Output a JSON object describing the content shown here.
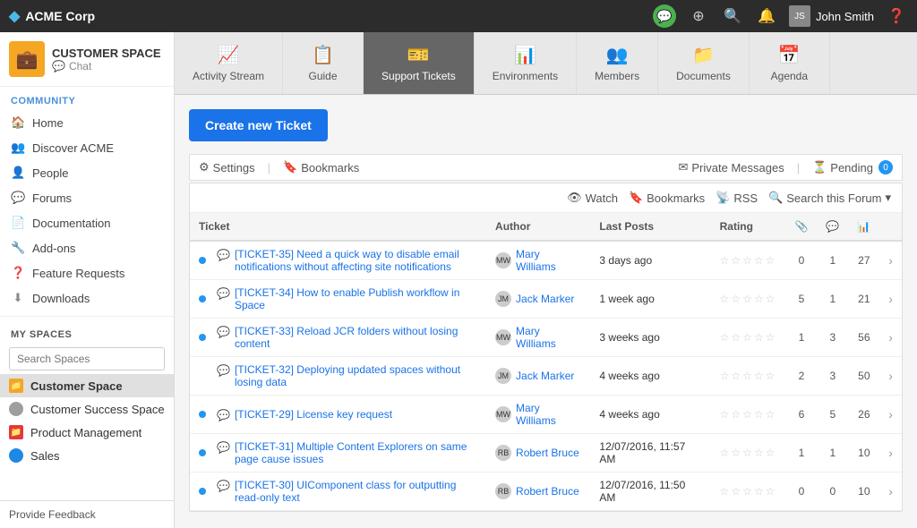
{
  "app": {
    "name": "ACME Corp"
  },
  "topnav": {
    "username": "John Smith",
    "icons": [
      "chat",
      "add",
      "search",
      "bell",
      "user",
      "help"
    ]
  },
  "sidebar": {
    "space_title": "CUSTOMER SPACE",
    "space_chat": "Chat",
    "community_title": "COMMUNITY",
    "nav_items": [
      {
        "label": "Home",
        "icon": "🏠"
      },
      {
        "label": "Discover ACME",
        "icon": "👥"
      },
      {
        "label": "People",
        "icon": "👤"
      },
      {
        "label": "Forums",
        "icon": "💬"
      },
      {
        "label": "Documentation",
        "icon": "📄"
      },
      {
        "label": "Add-ons",
        "icon": "🔧"
      },
      {
        "label": "Feature Requests",
        "icon": "❓"
      },
      {
        "label": "Downloads",
        "icon": "⬇"
      }
    ],
    "my_spaces_title": "MY SPACES",
    "search_spaces_placeholder": "Search Spaces",
    "spaces": [
      {
        "label": "Customer Space",
        "color": "#f5a623",
        "active": true
      },
      {
        "label": "Customer Success Space",
        "color": "#9e9e9e"
      },
      {
        "label": "Product Management",
        "color": "#e53935"
      },
      {
        "label": "Sales",
        "color": "#1e88e5"
      }
    ],
    "provide_feedback": "Provide Feedback"
  },
  "tabs": [
    {
      "label": "Activity Stream",
      "icon": "📈"
    },
    {
      "label": "Guide",
      "icon": "📋"
    },
    {
      "label": "Support Tickets",
      "icon": "🎫",
      "active": true
    },
    {
      "label": "Environments",
      "icon": "📊"
    },
    {
      "label": "Members",
      "icon": "👥"
    },
    {
      "label": "Documents",
      "icon": "📁"
    },
    {
      "label": "Agenda",
      "icon": "📅"
    }
  ],
  "page": {
    "create_ticket_label": "Create new Ticket",
    "toolbar": {
      "settings_label": "Settings",
      "bookmarks_label": "Bookmarks",
      "private_messages_label": "Private Messages",
      "pending_label": "Pending",
      "pending_count": "0"
    },
    "table_toolbar": {
      "watch_label": "Watch",
      "bookmarks_label": "Bookmarks",
      "rss_label": "RSS",
      "search_label": "Search this Forum"
    },
    "columns": [
      "Ticket",
      "Author",
      "Last Posts",
      "Rating",
      "",
      "",
      ""
    ],
    "tickets": [
      {
        "unread": true,
        "id": "TICKET-35",
        "title": "Need a quick way to disable email notifications without affecting site notifications",
        "author": "Mary Williams",
        "last_post": "3 days ago",
        "stars": "☆☆☆☆☆",
        "attach": "0",
        "replies": "1",
        "views": "27"
      },
      {
        "unread": true,
        "id": "TICKET-34",
        "title": "How to enable Publish workflow in Space",
        "author": "Jack Marker",
        "last_post": "1 week ago",
        "stars": "☆☆☆☆☆",
        "attach": "5",
        "replies": "1",
        "views": "21"
      },
      {
        "unread": true,
        "id": "TICKET-33",
        "title": "Reload JCR folders without losing content",
        "author": "Mary Williams",
        "last_post": "3 weeks ago",
        "stars": "☆☆☆☆☆",
        "attach": "1",
        "replies": "3",
        "views": "56"
      },
      {
        "unread": false,
        "id": "TICKET-32",
        "title": "Deploying updated spaces without losing data",
        "author": "Jack Marker",
        "last_post": "4 weeks ago",
        "stars": "☆☆☆☆☆",
        "attach": "2",
        "replies": "3",
        "views": "50"
      },
      {
        "unread": true,
        "id": "TICKET-29",
        "title": "License key request",
        "author": "Mary Williams",
        "last_post": "4 weeks ago",
        "stars": "☆☆☆☆☆",
        "attach": "6",
        "replies": "5",
        "views": "26"
      },
      {
        "unread": true,
        "id": "TICKET-31",
        "title": "Multiple Content Explorers on same page cause issues",
        "author": "Robert Bruce",
        "last_post": "12/07/2016, 11:57 AM",
        "stars": "☆☆☆☆☆",
        "attach": "1",
        "replies": "1",
        "views": "10"
      },
      {
        "unread": true,
        "id": "TICKET-30",
        "title": "UIComponent class for outputting read-only text",
        "author": "Robert Bruce",
        "last_post": "12/07/2016, 11:50 AM",
        "stars": "☆☆☆☆☆",
        "attach": "0",
        "replies": "0",
        "views": "10"
      }
    ]
  }
}
